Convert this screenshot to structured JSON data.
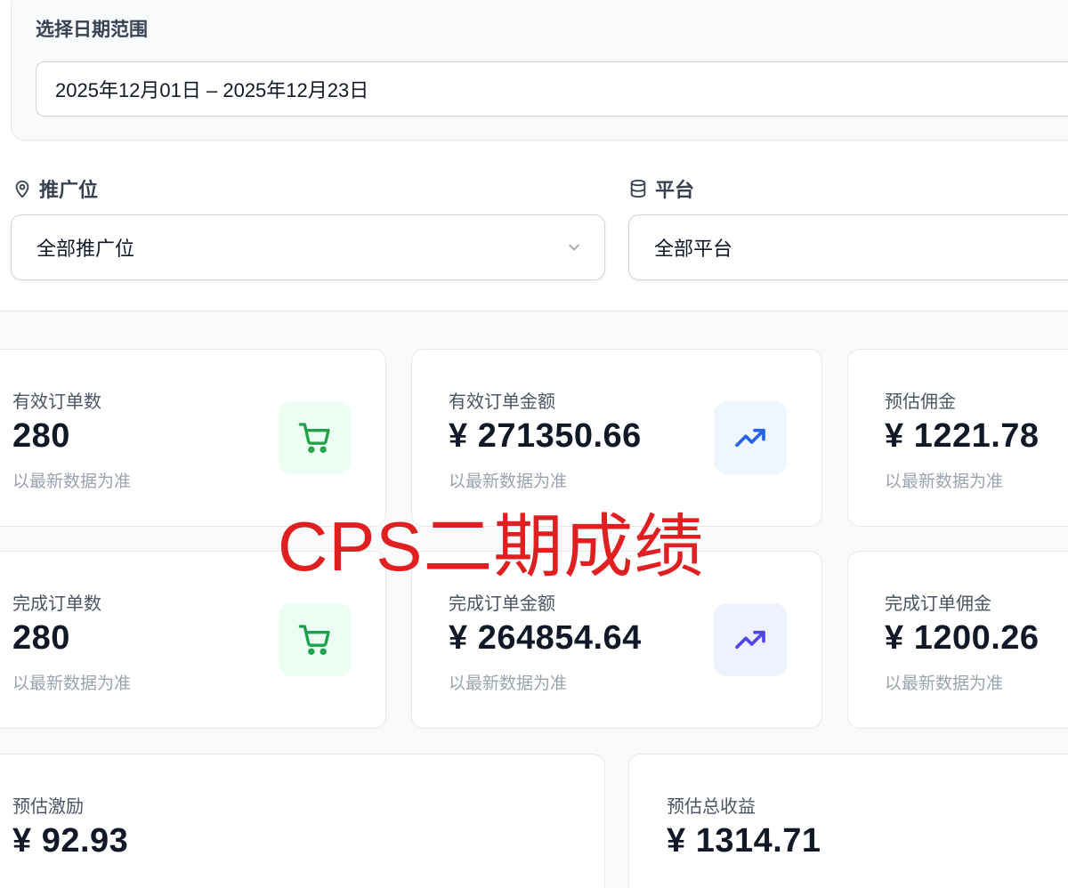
{
  "date_range": {
    "title": "选择日期范围",
    "value": "2025年12月01日 – 2025年12月23日"
  },
  "filters": {
    "placement": {
      "label": "推广位",
      "icon": "location-pin-icon",
      "value": "全部推广位"
    },
    "platform": {
      "label": "平台",
      "icon": "database-icon",
      "value": "全部平台"
    }
  },
  "stats": [
    {
      "label": "有效订单数",
      "value": "280",
      "note": "以最新数据为准",
      "icon": "cart-icon",
      "accent": "#22a34a"
    },
    {
      "label": "有效订单金额",
      "value": "¥ 271350.66",
      "note": "以最新数据为准",
      "icon": "trending-up-icon",
      "accent": "#2563eb"
    },
    {
      "label": "预估佣金",
      "value": "¥ 1221.78",
      "note": "以最新数据为准"
    },
    {
      "label": "完成订单数",
      "value": "280",
      "note": "以最新数据为准",
      "icon": "cart-icon",
      "accent": "#16a34a"
    },
    {
      "label": "完成订单金额",
      "value": "¥ 264854.64",
      "note": "以最新数据为准",
      "icon": "trending-up-icon",
      "accent": "#4f46e5"
    },
    {
      "label": "完成订单佣金",
      "value": "¥ 1200.26",
      "note": "以最新数据为准"
    },
    {
      "label": "预估激励",
      "value": "¥ 92.93"
    },
    {
      "label": "预估总收益",
      "value": "¥ 1314.71"
    }
  ],
  "overlay_text": "CPS二期成绩"
}
